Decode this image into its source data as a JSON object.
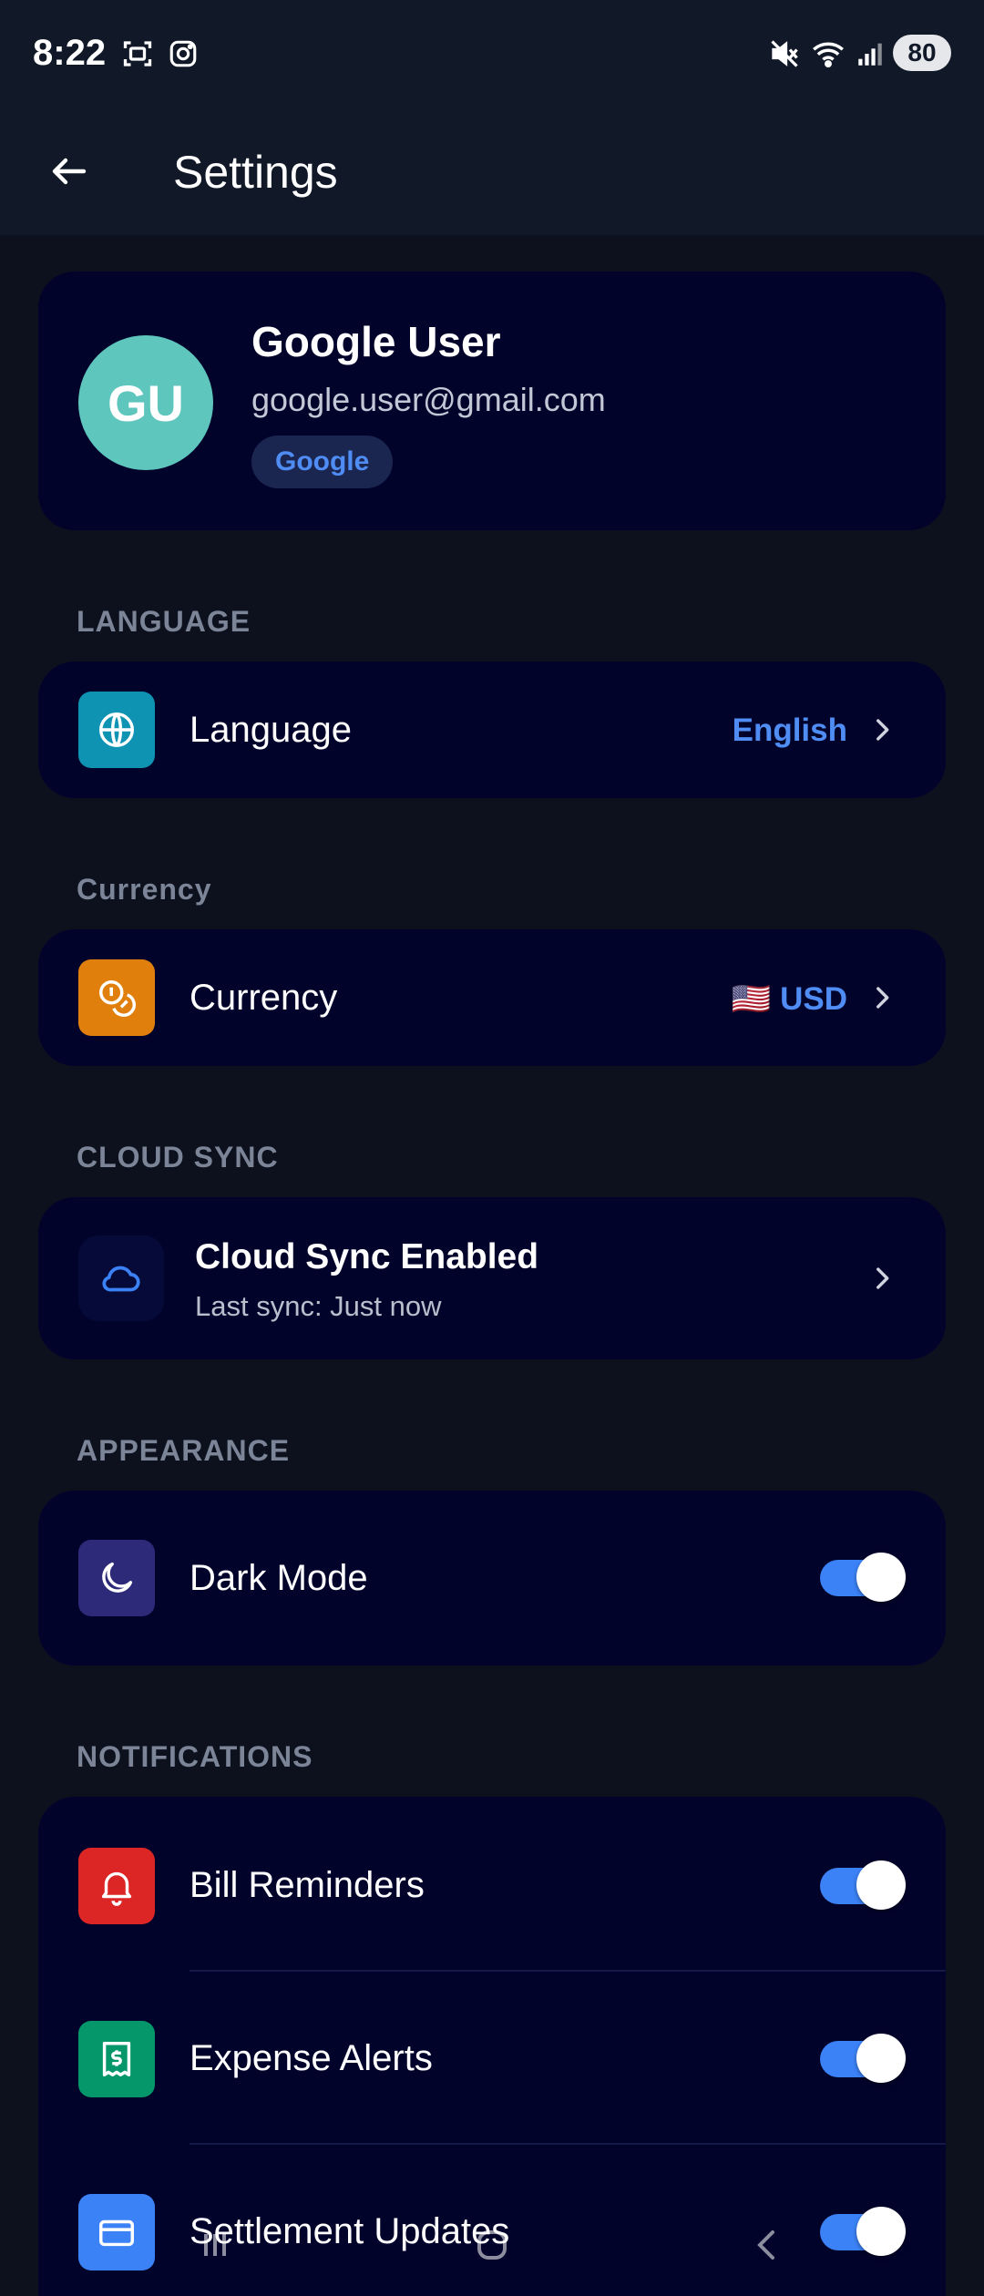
{
  "status_bar": {
    "time": "8:22",
    "battery": "80",
    "icons": [
      "screenshot-icon",
      "instagram-icon",
      "mute-icon",
      "wifi-icon",
      "signal-icon"
    ]
  },
  "app_bar": {
    "title": "Settings",
    "back_icon": "arrow-left-icon"
  },
  "profile": {
    "initials": "GU",
    "name": "Google User",
    "email": "google.user@gmail.com",
    "provider": "Google",
    "avatar_color": "#5ec6bd"
  },
  "sections": {
    "language": {
      "header": "LANGUAGE",
      "label": "Language",
      "value": "English",
      "icon": "globe-icon",
      "icon_color": "#0e93b3"
    },
    "currency": {
      "header": "Currency",
      "label": "Currency",
      "flag": "🇺🇸",
      "value": "USD",
      "icon": "coins-icon",
      "icon_color": "#e07f0c"
    },
    "cloud_sync": {
      "header": "CLOUD SYNC",
      "title": "Cloud Sync Enabled",
      "subtitle": "Last sync: Just now",
      "icon": "cloud-icon",
      "icon_color": "#060a38"
    },
    "appearance": {
      "header": "APPEARANCE",
      "label": "Dark Mode",
      "enabled": true,
      "icon": "moon-icon",
      "icon_color": "#2d2a7a"
    },
    "notifications": {
      "header": "NOTIFICATIONS",
      "items": [
        {
          "label": "Bill Reminders",
          "enabled": true,
          "icon": "bell-icon",
          "icon_color": "#dc2626"
        },
        {
          "label": "Expense Alerts",
          "enabled": true,
          "icon": "receipt-icon",
          "icon_color": "#059669"
        },
        {
          "label": "Settlement Updates",
          "enabled": true,
          "icon": "card-icon",
          "icon_color": "#3b82f6"
        }
      ]
    }
  },
  "accent_color": "#4f8df5",
  "nav_bar": {
    "icons": [
      "recent-apps-icon",
      "home-icon",
      "back-nav-icon"
    ]
  }
}
